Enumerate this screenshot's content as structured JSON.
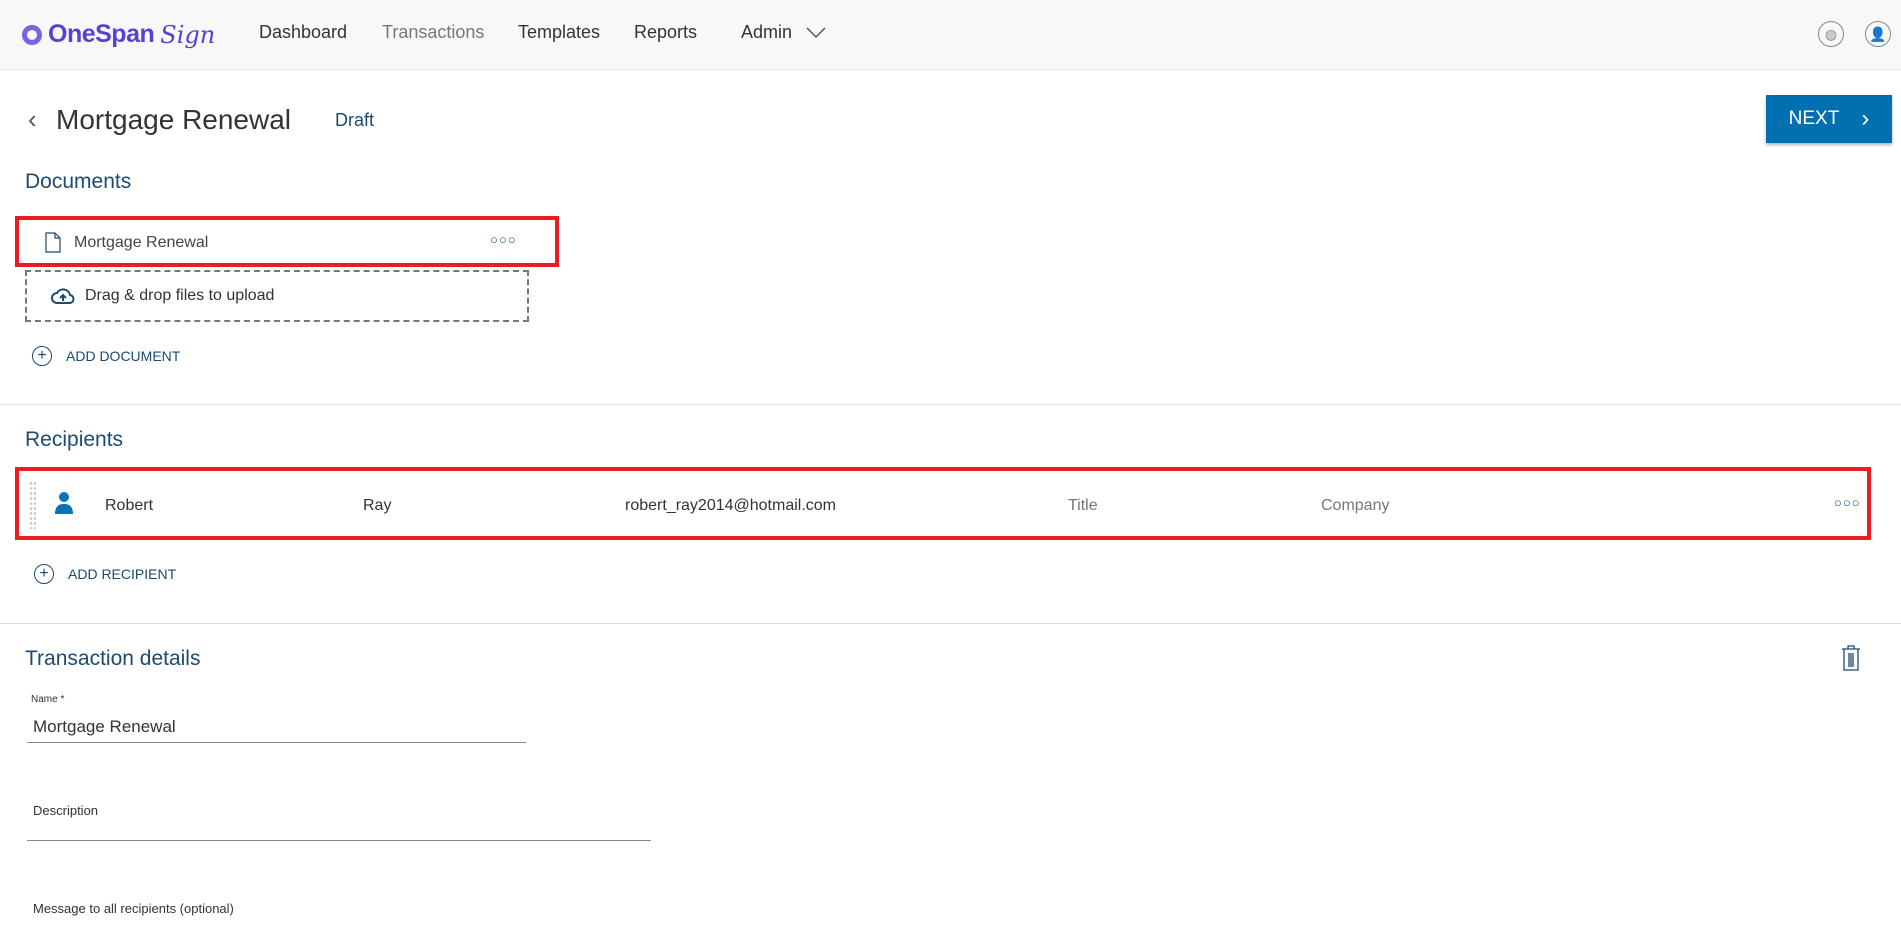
{
  "header": {
    "logo": "OneSpan Sign",
    "logo_main": "OneSpan",
    "logo_script": "Sign",
    "nav": [
      "Dashboard",
      "Transactions",
      "Templates",
      "Reports",
      "Admin"
    ],
    "active_nav": "Transactions",
    "icons": [
      "globe-icon",
      "user-profile-icon"
    ]
  },
  "page": {
    "title": "Mortgage Renewal",
    "status": "Draft",
    "next_label": "NEXT"
  },
  "documents": {
    "heading": "Documents",
    "items": [
      {
        "name": "Mortgage Renewal"
      }
    ],
    "upload_text": "Drag & drop files to upload",
    "add_label": "ADD DOCUMENT"
  },
  "recipients": {
    "heading": "Recipients",
    "items": [
      {
        "first_name": "Robert",
        "last_name": "Ray",
        "email": "robert_ray2014@hotmail.com",
        "title_placeholder": "Title",
        "company_placeholder": "Company"
      }
    ],
    "add_label": "ADD RECIPIENT"
  },
  "details": {
    "heading": "Transaction details",
    "name_label": "Name *",
    "name_value": "Mortgage Renewal",
    "description_label": "Description",
    "message_label": "Message to all recipients (optional)"
  },
  "colors": {
    "brand": "#5b3fd1",
    "primary": "#0070b0",
    "heading": "#1a4b73",
    "highlight": "#ed1c24"
  }
}
